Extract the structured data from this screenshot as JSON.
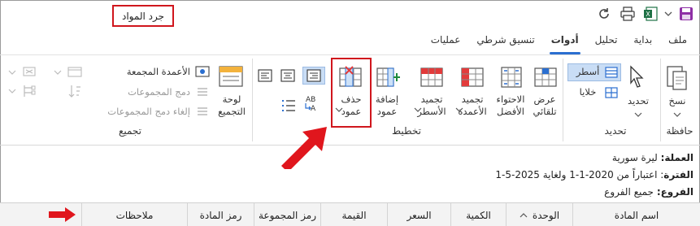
{
  "window": {
    "title": "جرد المواد"
  },
  "tabs": [
    {
      "label": "ملف",
      "active": false
    },
    {
      "label": "بداية",
      "active": false
    },
    {
      "label": "تحليل",
      "active": false
    },
    {
      "label": "أدوات",
      "active": true
    },
    {
      "label": "تنسيق شرطي",
      "active": false
    },
    {
      "label": "عمليات",
      "active": false
    }
  ],
  "ribbon": {
    "clipboard": {
      "paste_line1": "نسخ",
      "group_label": "حافظة"
    },
    "selection": {
      "select_label": "تحديد",
      "rows_label": "أسطر",
      "cells_label": "خلايا",
      "group_label": "تحديد"
    },
    "layout": {
      "auto_fit_line1": "عرض",
      "auto_fit_line2": "تلقائي",
      "best_fit_line1": "الاحتواء",
      "best_fit_line2": "الأفضل",
      "freeze_cols_line1": "تجميد",
      "freeze_cols_line2": "الأعمدة",
      "freeze_rows_line1": "تجميد",
      "freeze_rows_line2": "الأسطر",
      "add_col_line1": "إضافة",
      "add_col_line2": "عمود",
      "delete_col_line1": "حذف",
      "delete_col_line2": "عمود",
      "ab_label": "AB",
      "ab_sub": "A",
      "group_label": "تخطيط"
    },
    "grouping": {
      "panel_line1": "لوحة",
      "panel_line2": "التجميع",
      "grouped_columns": "الأعمدة المجمعة",
      "merge_groups": "دمج المجموعات",
      "unmerge_groups": "إلغاء دمج المجموعات",
      "group_label": "تجميع"
    }
  },
  "info": {
    "currency_label": "العملة:",
    "currency_value": "ليرة سورية",
    "period_label": "الفترة",
    "period_value": ": اعتباراً من 2020-1-1 ولغاية 2025-5-1",
    "branch_label": "الفروع:",
    "branch_value": "جميع الفروع"
  },
  "grid": {
    "columns": [
      "اسم المادة",
      "الوحدة",
      "الكمية",
      "السعر",
      "القيمة",
      "رمز المجموعة",
      "رمز المادة",
      "ملاحظات"
    ]
  },
  "colors": {
    "annotation_red": "#d0161d",
    "accent_blue": "#2b6fd0"
  }
}
